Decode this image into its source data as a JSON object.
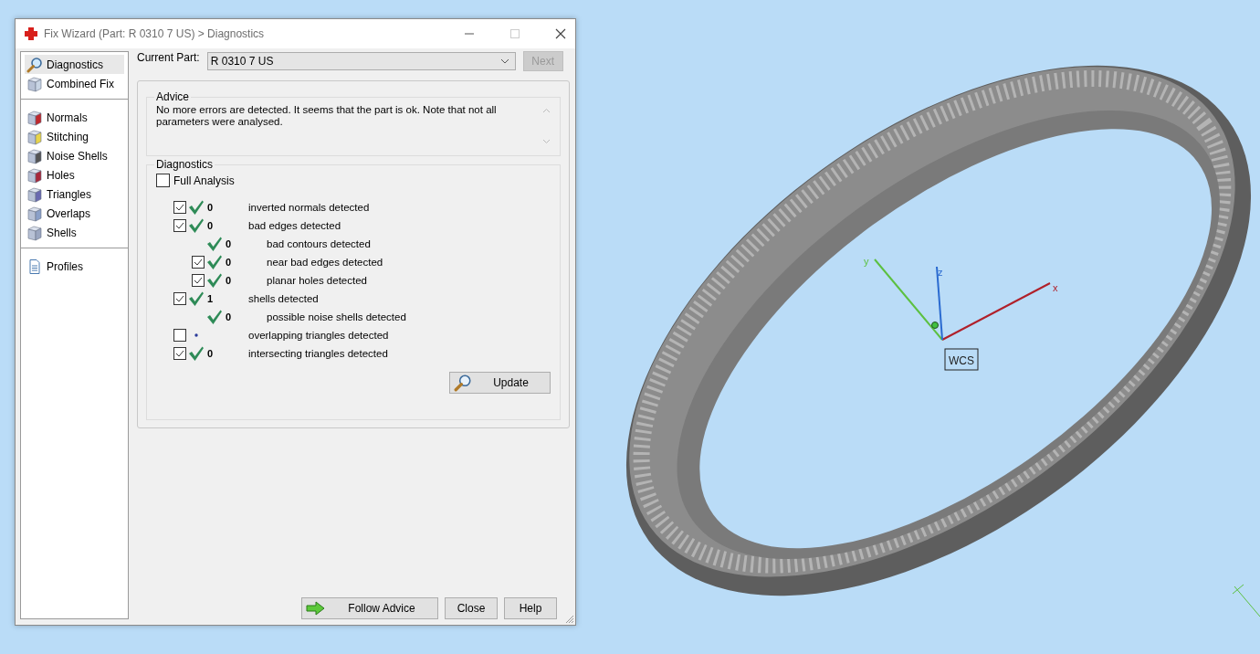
{
  "window": {
    "title": "Fix Wizard (Part: R 0310 7 US) > Diagnostics"
  },
  "sidebar": {
    "groups": [
      [
        {
          "label": "Diagnostics",
          "selected": true
        },
        {
          "label": "Combined Fix",
          "selected": false
        }
      ],
      [
        {
          "label": "Normals",
          "selected": false
        },
        {
          "label": "Stitching",
          "selected": false
        },
        {
          "label": "Noise Shells",
          "selected": false
        },
        {
          "label": "Holes",
          "selected": false
        },
        {
          "label": "Triangles",
          "selected": false
        },
        {
          "label": "Overlaps",
          "selected": false
        },
        {
          "label": "Shells",
          "selected": false
        }
      ],
      [
        {
          "label": "Profiles",
          "selected": false
        }
      ]
    ]
  },
  "current_part": {
    "label": "Current Part:",
    "value": "R 0310 7 US"
  },
  "next_button": {
    "label": "Next",
    "disabled": true
  },
  "advice": {
    "title": "Advice",
    "text": "No more errors are detected. It seems that the part is ok. Note that not all parameters were analysed."
  },
  "diagnostics": {
    "title": "Diagnostics",
    "full_analysis": {
      "label": "Full Analysis",
      "checked": false
    },
    "rows": [
      {
        "count": "0",
        "label": "inverted normals detected",
        "checked": true,
        "passed": true
      },
      {
        "count": "0",
        "label": "bad edges detected",
        "checked": true,
        "passed": true,
        "children": [
          {
            "count": "0",
            "label": "bad contours detected",
            "passed": true
          },
          {
            "count": "0",
            "label": "near bad edges detected",
            "checked": true,
            "passed": true
          },
          {
            "count": "0",
            "label": "planar holes detected",
            "checked": true,
            "passed": true
          }
        ]
      },
      {
        "count": "1",
        "label": "shells detected",
        "checked": true,
        "passed": true,
        "children": [
          {
            "count": "0",
            "label": "possible noise shells detected",
            "passed": true
          }
        ]
      },
      {
        "label": "overlapping triangles detected",
        "checked": false,
        "passed": false
      },
      {
        "count": "0",
        "label": "intersecting triangles detected",
        "checked": true,
        "passed": true
      }
    ],
    "update_button": "Update"
  },
  "buttons": [
    {
      "label": "Follow Advice",
      "kind": "advice"
    },
    {
      "label": "Close",
      "kind": "plain"
    },
    {
      "label": "Help",
      "kind": "plain"
    }
  ],
  "viewport": {
    "axes": [
      {
        "label": "x"
      },
      {
        "label": "y"
      },
      {
        "label": "z"
      }
    ],
    "wcs_label": "WCS"
  }
}
